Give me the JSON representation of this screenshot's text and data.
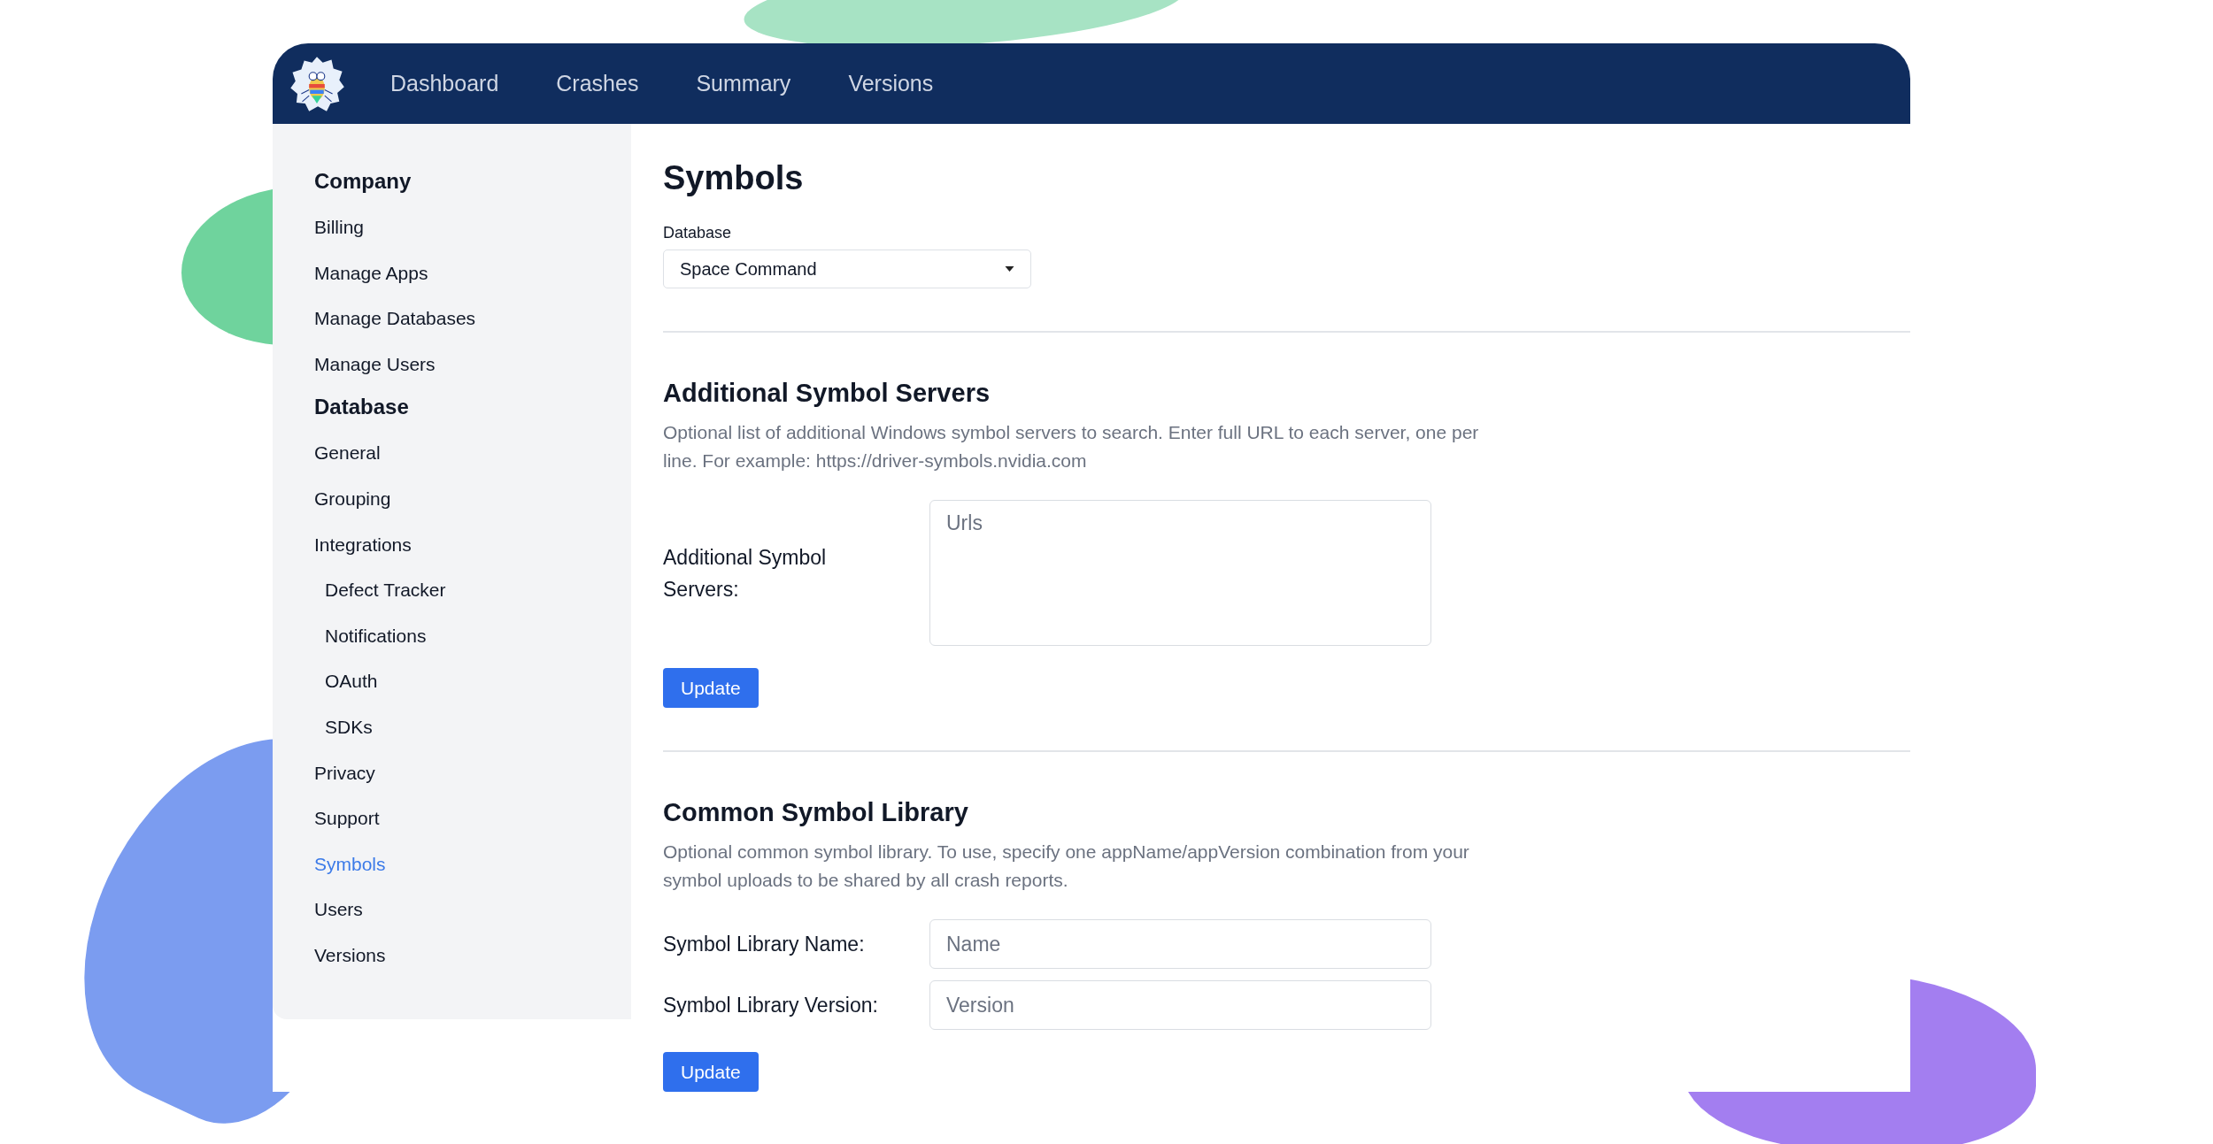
{
  "nav": {
    "items": [
      {
        "label": "Dashboard"
      },
      {
        "label": "Crashes"
      },
      {
        "label": "Summary"
      },
      {
        "label": "Versions"
      }
    ]
  },
  "sidebar": {
    "sections": [
      {
        "title": "Company",
        "items": [
          {
            "label": "Billing",
            "selected": false
          },
          {
            "label": "Manage Apps",
            "selected": false
          },
          {
            "label": "Manage Databases",
            "selected": false
          },
          {
            "label": "Manage Users",
            "selected": false
          }
        ]
      },
      {
        "title": "Database",
        "items": [
          {
            "label": "General",
            "selected": false
          },
          {
            "label": "Grouping",
            "selected": false
          },
          {
            "label": "Integrations",
            "selected": false,
            "children": [
              {
                "label": "Defect Tracker",
                "selected": false
              },
              {
                "label": "Notifications",
                "selected": false
              },
              {
                "label": "OAuth",
                "selected": false
              },
              {
                "label": "SDKs",
                "selected": false
              }
            ]
          },
          {
            "label": "Privacy",
            "selected": false
          },
          {
            "label": "Support",
            "selected": false
          },
          {
            "label": "Symbols",
            "selected": true
          },
          {
            "label": "Users",
            "selected": false
          },
          {
            "label": "Versions",
            "selected": false
          }
        ]
      }
    ]
  },
  "page": {
    "title": "Symbols",
    "database_select": {
      "label": "Database",
      "value": "Space Command"
    },
    "sections": [
      {
        "heading": "Additional Symbol Servers",
        "description": "Optional list of additional Windows symbol servers to search. Enter full URL to each server, one per line. For example: https://driver-symbols.nvidia.com",
        "fields": [
          {
            "kind": "textarea",
            "label": "Additional Symbol Servers:",
            "placeholder": "Urls"
          }
        ],
        "button": "Update"
      },
      {
        "heading": "Common Symbol Library",
        "description": "Optional common symbol library. To use, specify one appName/appVersion combination from your symbol uploads to be shared by all crash reports.",
        "fields": [
          {
            "kind": "input",
            "label": "Symbol Library Name:",
            "placeholder": "Name"
          },
          {
            "kind": "input",
            "label": "Symbol Library Version:",
            "placeholder": "Version"
          }
        ],
        "button": "Update"
      }
    ]
  }
}
